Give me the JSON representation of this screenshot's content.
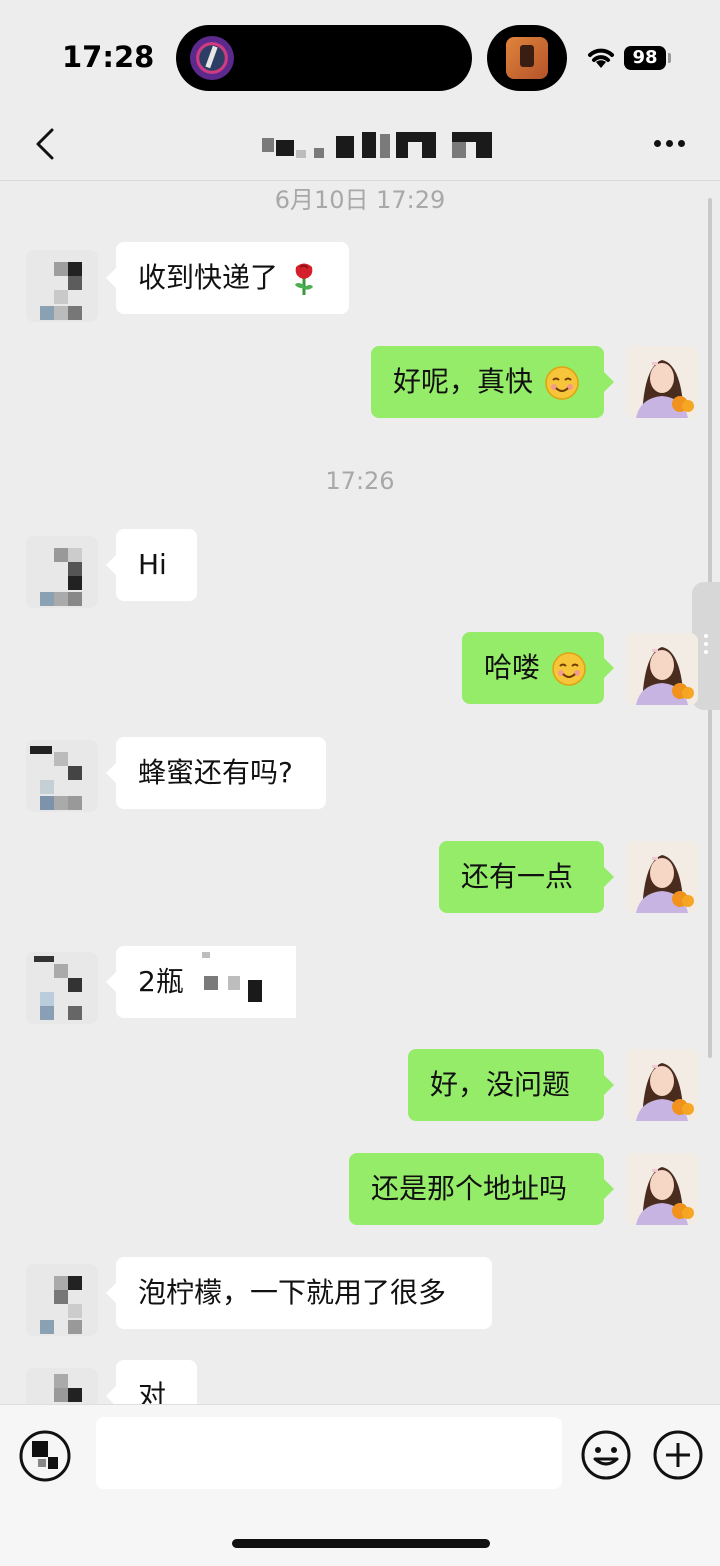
{
  "status_bar": {
    "time": "17:28",
    "battery": "98"
  },
  "header": {
    "title": ""
  },
  "input": {
    "placeholder": ""
  },
  "messages": [
    {
      "kind": "timestamp",
      "text": "6月10日 17:29"
    },
    {
      "kind": "in",
      "text": "收到快递了",
      "emoji": "rose"
    },
    {
      "kind": "out",
      "text": "好呢，真快",
      "emoji": "smile"
    },
    {
      "kind": "timestamp",
      "text": "17:26"
    },
    {
      "kind": "in",
      "text": "Hi"
    },
    {
      "kind": "out",
      "text": "哈喽",
      "emoji": "smile"
    },
    {
      "kind": "in",
      "text": "蜂蜜还有吗?"
    },
    {
      "kind": "out",
      "text": "还有一点"
    },
    {
      "kind": "in",
      "text": "2瓶"
    },
    {
      "kind": "out",
      "text": "好，没问题"
    },
    {
      "kind": "out",
      "text": "还是那个地址吗"
    },
    {
      "kind": "in",
      "text": "泡柠檬，一下就用了很多"
    },
    {
      "kind": "in",
      "text": "对"
    }
  ],
  "colors": {
    "background": "#ededed",
    "bubble_out": "#95ec69",
    "bubble_in": "#ffffff",
    "timestamp": "#a8a8a8"
  },
  "icons": [
    "back-icon",
    "more-icon",
    "voice-icon",
    "emoji-icon",
    "plus-icon",
    "wifi-icon",
    "battery-icon"
  ]
}
